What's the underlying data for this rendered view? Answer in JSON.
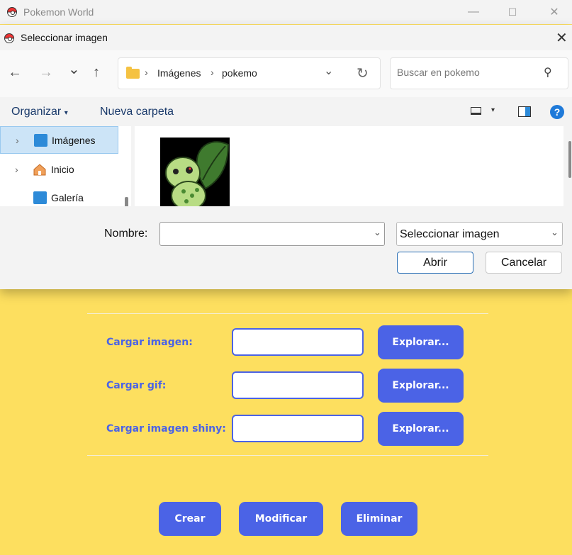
{
  "main_window": {
    "title": "Pokemon World",
    "controls": {
      "minimize": "—",
      "maximize": "☐",
      "close": "✕"
    }
  },
  "form": {
    "rows": [
      {
        "label": "Cargar imagen:",
        "button": "Explorar..."
      },
      {
        "label": "Cargar gif:",
        "button": "Explorar..."
      },
      {
        "label": "Cargar imagen shiny:",
        "button": "Explorar..."
      }
    ],
    "actions": {
      "create": "Crear",
      "modify": "Modificar",
      "delete": "Eliminar"
    }
  },
  "dialog": {
    "title": "Seleccionar imagen",
    "nav": {
      "back": "←",
      "forward": "→",
      "recent": "⌄",
      "up": "↑"
    },
    "breadcrumb": [
      "Imágenes",
      "pokemo"
    ],
    "search_placeholder": "Buscar en pokemo",
    "toolbar": {
      "organize": "Organizar",
      "new_folder": "Nueva carpeta"
    },
    "sidebar": [
      {
        "label": "Imágenes",
        "icon": "pictures-icon",
        "selected": true
      },
      {
        "label": "Inicio",
        "icon": "home-icon",
        "selected": false
      },
      {
        "label": "Galería",
        "icon": "gallery-icon",
        "selected": false
      }
    ],
    "filename_label": "Nombre:",
    "filename_value": "",
    "filetype_value": "Seleccionar imagen",
    "open_button": "Abrir",
    "cancel_button": "Cancelar"
  },
  "colors": {
    "background": "#fddf5f",
    "accent": "#4b63e6",
    "selection": "#cce4f7"
  }
}
